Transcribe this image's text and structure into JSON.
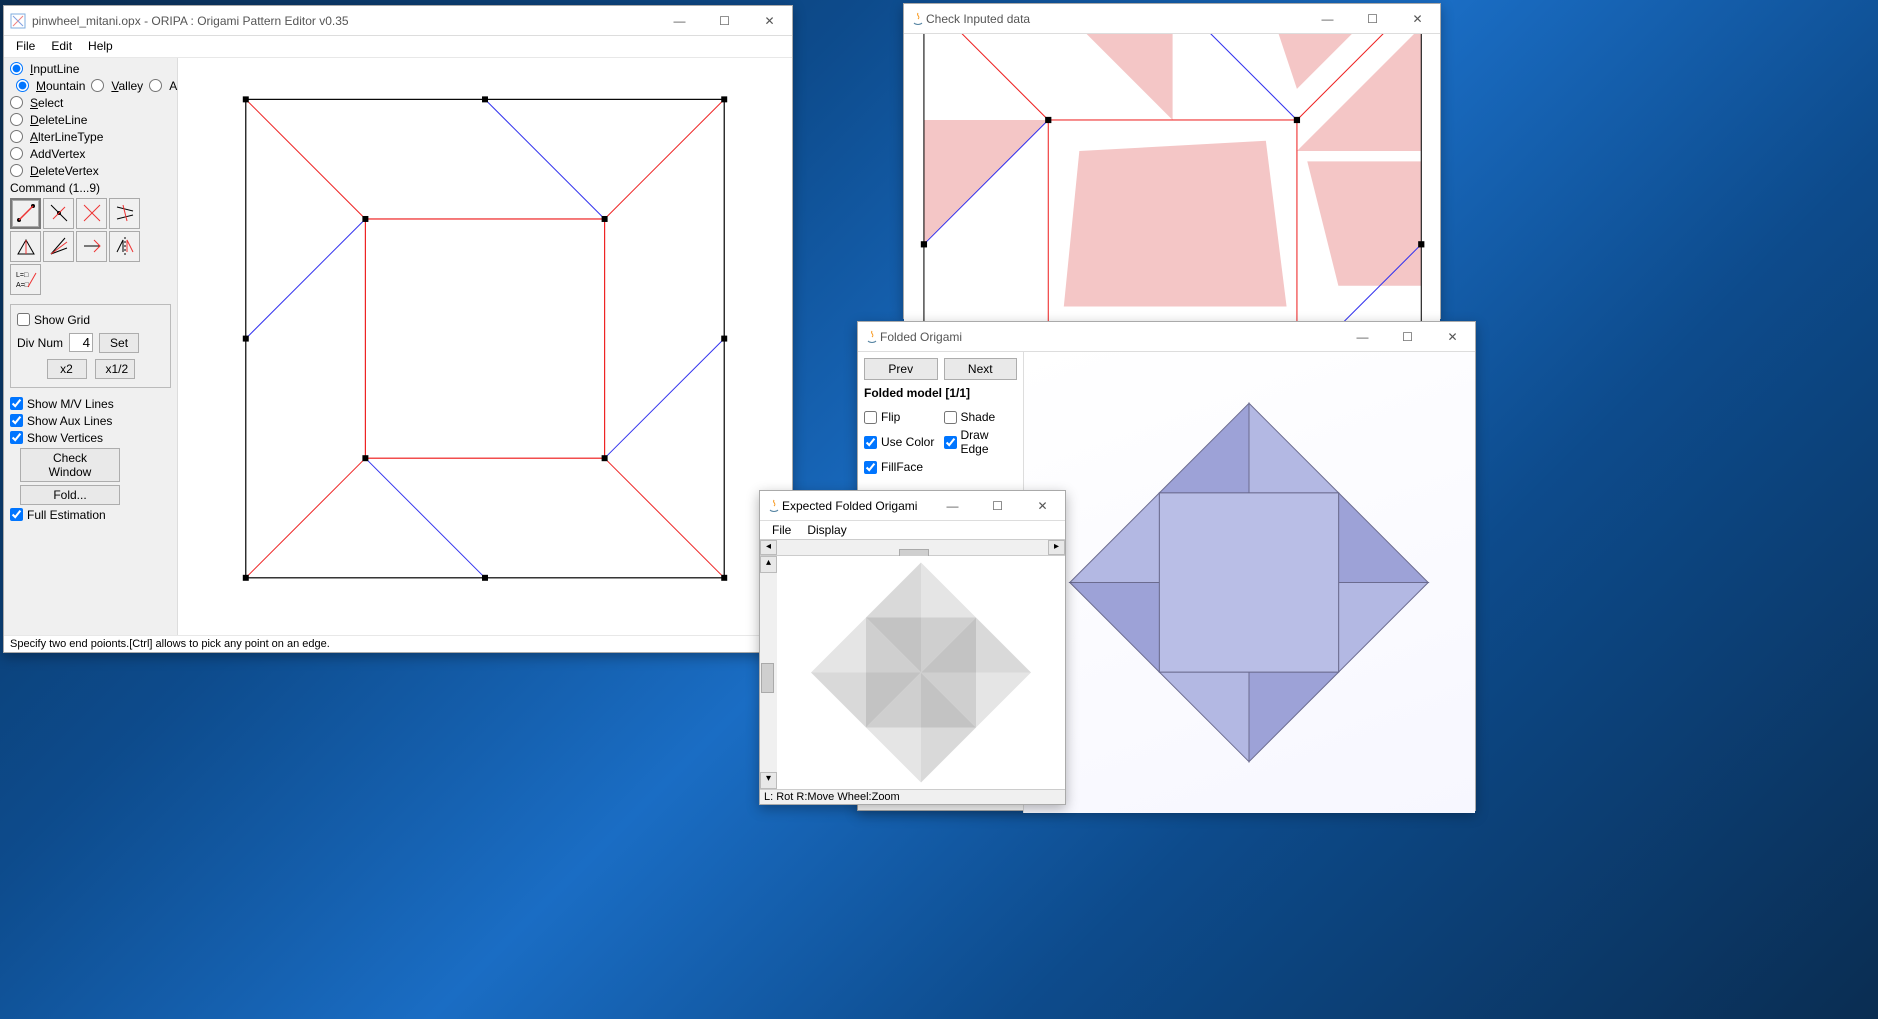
{
  "oripa": {
    "title": "pinwheel_mitani.opx - ORIPA : Origami Pattern Editor  v0.35",
    "menu": {
      "file": "File",
      "edit": "Edit",
      "help": "Help"
    },
    "tools": {
      "inputLine": "InputLine",
      "mountain": "Mountain",
      "valley": "Valley",
      "aux": "Aux",
      "select": "Select",
      "deleteLine": "DeleteLine",
      "alterLineType": "AlterLineType",
      "addVertex": "AddVertex",
      "deleteVertex": "DeleteVertex"
    },
    "commandLabel": "Command (1...9)",
    "grid": {
      "showGrid": "Show Grid",
      "divNumLabel": "Div Num",
      "divNumValue": "4",
      "set": "Set",
      "x2": "x2",
      "x1_2": "x1/2"
    },
    "checks": {
      "showMV": "Show M/V Lines",
      "showAux": "Show Aux Lines",
      "showVertices": "Show Vertices",
      "checkWindow": "Check Window",
      "fold": "Fold...",
      "fullEstimation": "Full Estimation"
    },
    "status": "Specify two end poionts.[Ctrl] allows to pick any point on an edge."
  },
  "checkWindow": {
    "title": "Check Inputed data"
  },
  "folded": {
    "title": "Folded Origami",
    "prev": "Prev",
    "next": "Next",
    "modelLabel": "Folded model [1/1]",
    "opts": {
      "flip": "Flip",
      "shade": "Shade",
      "useColor": "Use Color",
      "drawEdge": "Draw Edge",
      "fillFace": "FillFace"
    }
  },
  "expected": {
    "title": "Expected Folded Origami",
    "menu": {
      "file": "File",
      "display": "Display"
    },
    "status": "L: Rot R:Move Wheel:Zoom"
  },
  "winControls": {
    "min": "—",
    "max": "☐",
    "close": "✕"
  }
}
